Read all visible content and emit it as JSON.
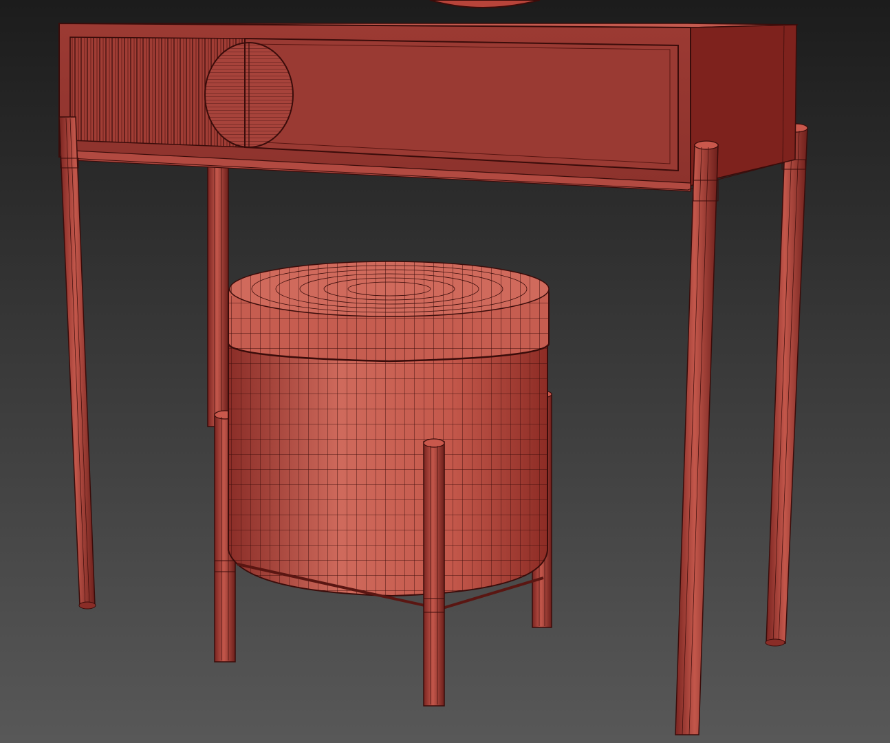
{
  "scene": {
    "subject": "wireframe-dressing-table-with-pouf",
    "background_top": "#1f1f1f",
    "background_bottom": "#565656",
    "model_color": "#b8443a",
    "model_light": "#cf5a4d",
    "model_dark": "#7a2420",
    "wire_color": "#3a0c0a"
  }
}
